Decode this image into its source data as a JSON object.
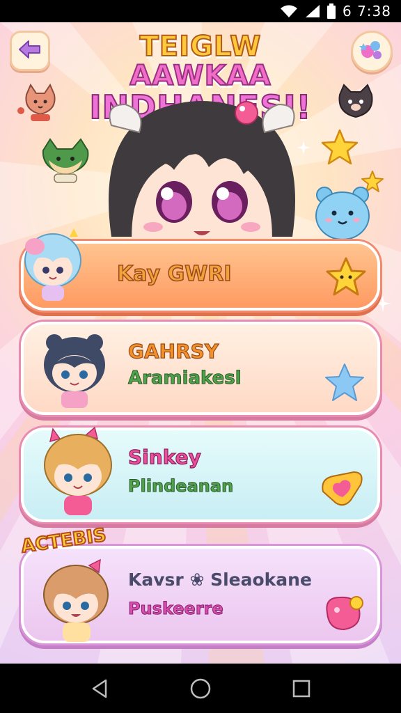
{
  "status_bar": {
    "time": "6 7:38",
    "icons": [
      "wifi-icon",
      "signal-icon",
      "battery-icon"
    ]
  },
  "header": {
    "title_line1_a": "TEIGLW",
    "title_line1_b": "AAWKAA",
    "title_line2": "INDHANESI!",
    "back_icon": "arrow-left-icon",
    "menu_icon": "sticker-cluster-icon"
  },
  "cards": [
    {
      "title": "Kay GWRI",
      "subtitle": "",
      "icon": "gold-star-icon",
      "title_color": "#f2a23a",
      "subtitle_color": ""
    },
    {
      "title": "GAHRSY",
      "subtitle": "Aramiakesl",
      "icon": "blue-star-icon",
      "title_color": "#f2912a",
      "subtitle_color": "#4fa24a"
    },
    {
      "title": "Sinkey",
      "subtitle": "Plindeanan",
      "icon": "heart-icon",
      "title_color": "#ea4f9c",
      "subtitle_color": "#4fa24a"
    },
    {
      "title": "Kavsr ❀ Sleaokane",
      "subtitle": "Puskeerre",
      "icon": "pink-blob-icon",
      "title_color": "#4a4a6a",
      "subtitle_color": "#d64fb0",
      "tag": "ACTEBIS"
    }
  ],
  "nav": {
    "back_icon": "nav-back-icon",
    "home_icon": "nav-home-icon",
    "recents_icon": "nav-recents-icon"
  },
  "colors": {
    "accent_orange": "#ff9a62",
    "accent_pink": "#ef72d6",
    "title_yellow": "#ffc93a"
  }
}
